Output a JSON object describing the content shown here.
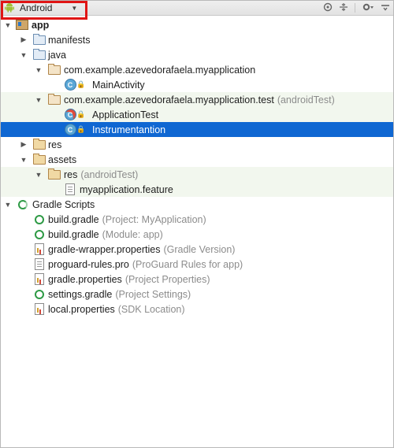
{
  "toolbar": {
    "view_selector_label": "Android",
    "icons": [
      "scope-icon",
      "collapse-icon",
      "settings-icon",
      "hide-icon"
    ]
  },
  "tree": {
    "app": "app",
    "manifests": "manifests",
    "java": "java",
    "pkg_main": "com.example.azevedorafaela.myapplication",
    "main_activity": "MainActivity",
    "pkg_test": "com.example.azevedorafaela.myapplication.test",
    "pkg_test_suffix": "(androidTest)",
    "application_test": "ApplicationTest",
    "instrumentation": "Instrumentantion",
    "res": "res",
    "assets": "assets",
    "assets_res": "res",
    "assets_res_suffix": "(androidTest)",
    "feature_file": "myapplication.feature",
    "gradle_scripts": "Gradle Scripts",
    "gradle_items": [
      {
        "name": "build.gradle",
        "hint": "(Project: MyApplication)"
      },
      {
        "name": "build.gradle",
        "hint": "(Module: app)"
      },
      {
        "name": "gradle-wrapper.properties",
        "hint": "(Gradle Version)"
      },
      {
        "name": "proguard-rules.pro",
        "hint": "(ProGuard Rules for app)"
      },
      {
        "name": "gradle.properties",
        "hint": "(Project Properties)"
      },
      {
        "name": "settings.gradle",
        "hint": "(Project Settings)"
      },
      {
        "name": "local.properties",
        "hint": "(SDK Location)"
      }
    ]
  },
  "colors": {
    "selection": "#0f67d2",
    "annotation_border": "#e01515",
    "test_row_bg": "#f2f7ee"
  }
}
